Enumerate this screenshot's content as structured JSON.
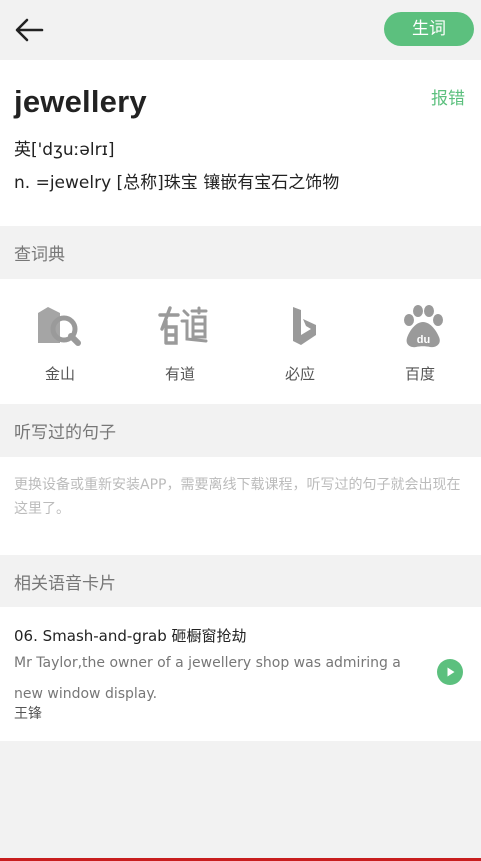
{
  "header": {
    "back_icon": "arrow-left-icon",
    "vocab_button_label": "生词"
  },
  "word": {
    "headword": "jewellery",
    "report_label": "报错",
    "phonetic": "英['dʒuːəlrɪ]",
    "definition": "n. =jewelry  [总称]珠宝 镶嵌有宝石之饰物"
  },
  "dictionary": {
    "section_title": "查词典",
    "items": [
      {
        "label": "金山",
        "icon": "jinshan-icon"
      },
      {
        "label": "有道",
        "icon": "youdao-icon"
      },
      {
        "label": "必应",
        "icon": "bing-icon"
      },
      {
        "label": "百度",
        "icon": "baidu-icon"
      }
    ]
  },
  "dictated": {
    "section_title": "听写过的句子",
    "empty_message": "更换设备或重新安装APP，需要离线下载课程，听写过的句子就会出现在这里了。"
  },
  "cards": {
    "section_title": "相关语音卡片",
    "items": [
      {
        "title": "06. Smash-and-grab 砸橱窗抢劫",
        "text": "Mr Taylor,the owner of a jewellery shop was admiring a new window display.",
        "author": "王锋",
        "play_icon": "play-icon"
      }
    ]
  },
  "colors": {
    "accent": "#5cc07e",
    "background": "#f2f2f2",
    "icon_gray": "#9a9a9a"
  }
}
